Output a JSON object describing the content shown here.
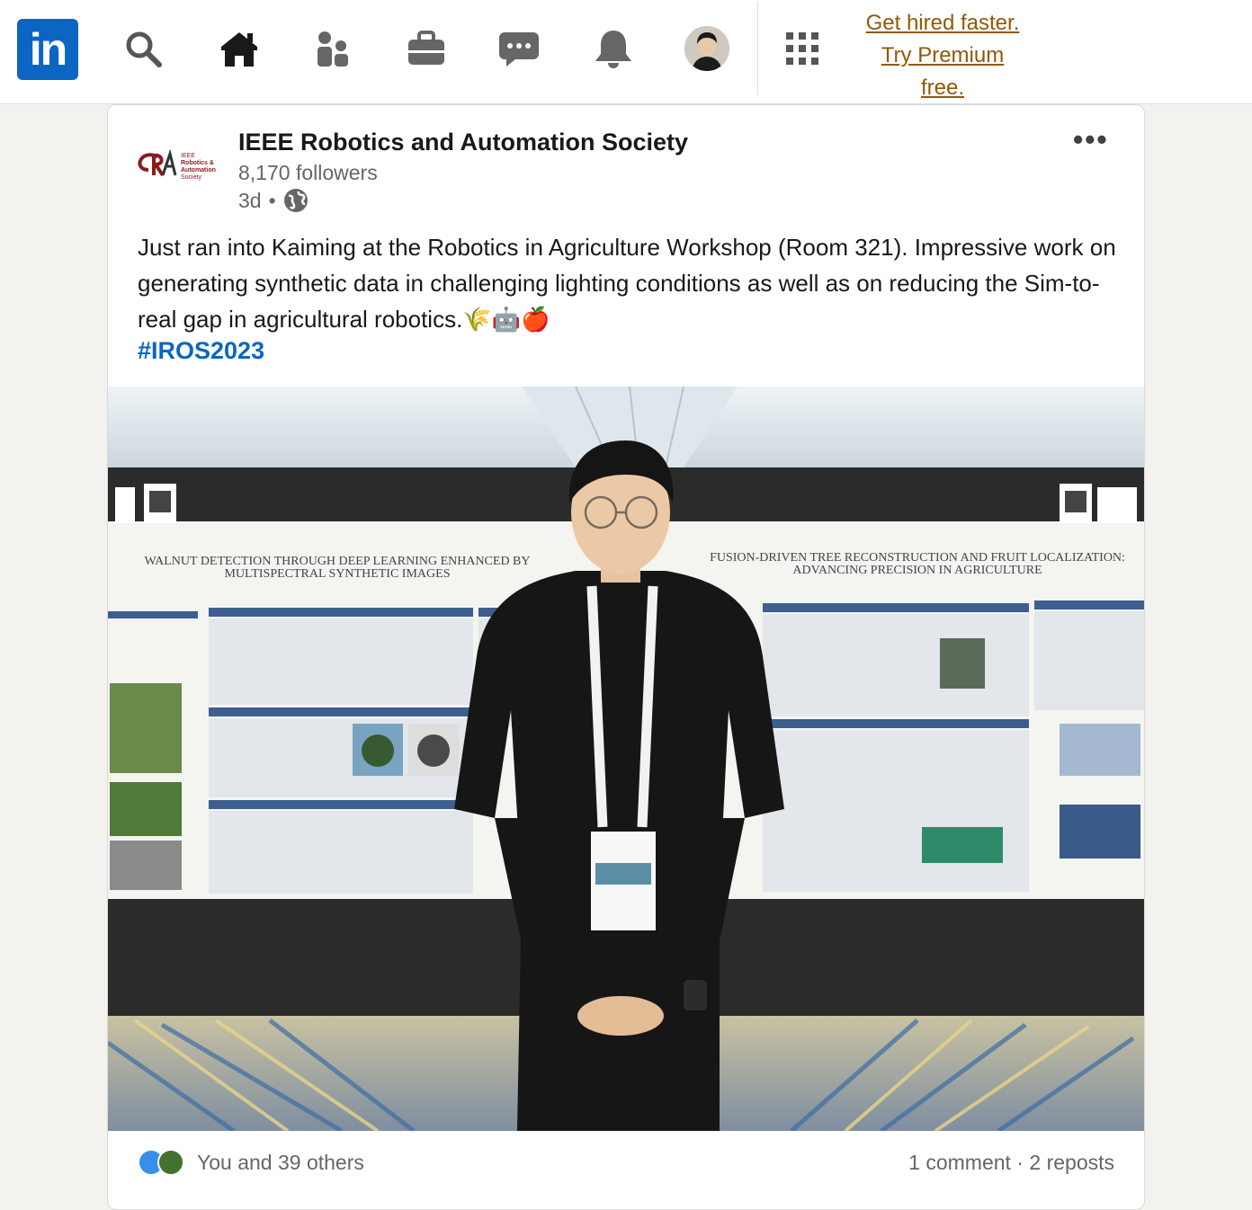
{
  "nav": {
    "logo_text": "in",
    "icons": [
      "search-icon",
      "home-icon",
      "network-icon",
      "jobs-icon",
      "messaging-icon",
      "notifications-icon",
      "profile-avatar",
      "apps-grid-icon"
    ],
    "premium_line1": "Get hired faster.",
    "premium_line2": "Try Premium",
    "premium_line3": "free.",
    "brand_color": "#0a66c2",
    "premium_color": "#915907"
  },
  "post": {
    "author": "IEEE Robotics and Automation Society",
    "followers": "8,170 followers",
    "age": "3d",
    "separator": "•",
    "visibility_icon": "globe-icon",
    "more_label": "•••",
    "text": "Just ran into Kaiming at the Robotics in Agriculture Workshop (Room 321). Impressive work on generating synthetic data in challenging lighting conditions as well as on reducing the Sim-to-real gap in agricultural robotics.🌾🤖🍎",
    "hashtag": "#IROS2023",
    "org_logo_text": "IEEE Robotics & Automation Society",
    "poster_left_title": "Walnut Detection through Deep Learning Enhanced by Multispectral Synthetic Images",
    "poster_right_title": "Fusion-Driven Tree Reconstruction and Fruit Localization: Advancing Precision in Agriculture"
  },
  "social": {
    "reactions_text": "You and 39 others",
    "comments": "1 comment",
    "dot": "·",
    "reposts": "2 reposts",
    "reaction_icons": [
      "like-icon",
      "support-icon"
    ]
  }
}
